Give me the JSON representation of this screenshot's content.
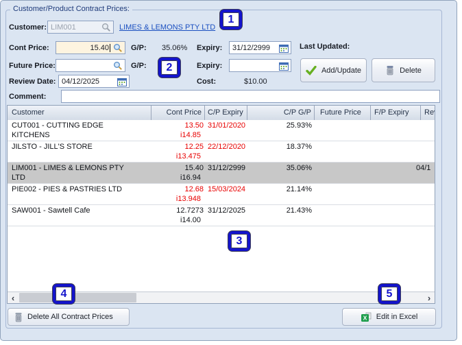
{
  "window": {
    "group_title": "Customer/Product Contract Prices:"
  },
  "form": {
    "customer": {
      "label": "Customer:",
      "code": "LIM001",
      "name_link": "LIMES & LEMONS PTY LTD"
    },
    "cont_price": {
      "label": "Cont Price:",
      "value": "15.40",
      "gp_label": "G/P:",
      "gp_value": "35.06%",
      "expiry_label": "Expiry:",
      "expiry_value": "31/12/2999"
    },
    "future_price": {
      "label": "Future Price:",
      "value": "",
      "gp_label": "G/P:",
      "gp_value": "",
      "expiry_label": "Expiry:",
      "expiry_value": ""
    },
    "review_date": {
      "label": "Review Date:",
      "value": "04/12/2025"
    },
    "cost": {
      "label": "Cost:",
      "value": "$10.00"
    },
    "last_updated": {
      "label": "Last Updated:",
      "value": ""
    },
    "comment": {
      "label": "Comment:",
      "value": ""
    },
    "actions": {
      "add_update": "Add/Update",
      "delete": "Delete"
    }
  },
  "grid": {
    "columns": [
      "Customer",
      "Cont Price",
      "C/P Expiry",
      "C/P G/P",
      "Future Price",
      "F/P Expiry",
      "Rev"
    ],
    "rows": [
      {
        "customer_line1": "CUT001 - CUTTING EDGE",
        "customer_line2": "KITCHENS",
        "cont_price": "13.50",
        "cont_price_inc": "i14.85",
        "cp_expiry": "31/01/2020",
        "cp_gp": "25.93%",
        "future_price": "",
        "fp_expiry": "",
        "review": "",
        "expired": true,
        "selected": false
      },
      {
        "customer_line1": "JILSTO - JILL'S STORE",
        "customer_line2": "",
        "cont_price": "12.25",
        "cont_price_inc": "i13.475",
        "cp_expiry": "22/12/2020",
        "cp_gp": "18.37%",
        "future_price": "",
        "fp_expiry": "",
        "review": "",
        "expired": true,
        "selected": false
      },
      {
        "customer_line1": "LIM001 - LIMES & LEMONS PTY",
        "customer_line2": "LTD",
        "cont_price": "15.40",
        "cont_price_inc": "i16.94",
        "cp_expiry": "31/12/2999",
        "cp_gp": "35.06%",
        "future_price": "",
        "fp_expiry": "",
        "review": "04/1",
        "expired": false,
        "selected": true
      },
      {
        "customer_line1": "PIE002 - PIES & PASTRIES LTD",
        "customer_line2": "",
        "cont_price": "12.68",
        "cont_price_inc": "i13.948",
        "cp_expiry": "15/03/2024",
        "cp_gp": "21.14%",
        "future_price": "",
        "fp_expiry": "",
        "review": "",
        "expired": true,
        "selected": false
      },
      {
        "customer_line1": "SAW001 - Sawtell Cafe",
        "customer_line2": "",
        "cont_price": "12.7273",
        "cont_price_inc": "i14.00",
        "cp_expiry": "31/12/2025",
        "cp_gp": "21.43%",
        "future_price": "",
        "fp_expiry": "",
        "review": "",
        "expired": false,
        "selected": false
      }
    ],
    "scrollbar": {
      "left_arrow": "‹",
      "right_arrow": "›"
    }
  },
  "footer": {
    "delete_all": "Delete All Contract Prices",
    "edit_in_excel": "Edit in Excel"
  },
  "callouts": [
    "1",
    "2",
    "3",
    "4",
    "5"
  ],
  "colors": {
    "expired_red": "#e80000",
    "selected_row": "#c8c8c8",
    "callout_blue": "#1414cc",
    "link_blue": "#1a4fc0",
    "accent_cream": "#fdf4e0"
  }
}
